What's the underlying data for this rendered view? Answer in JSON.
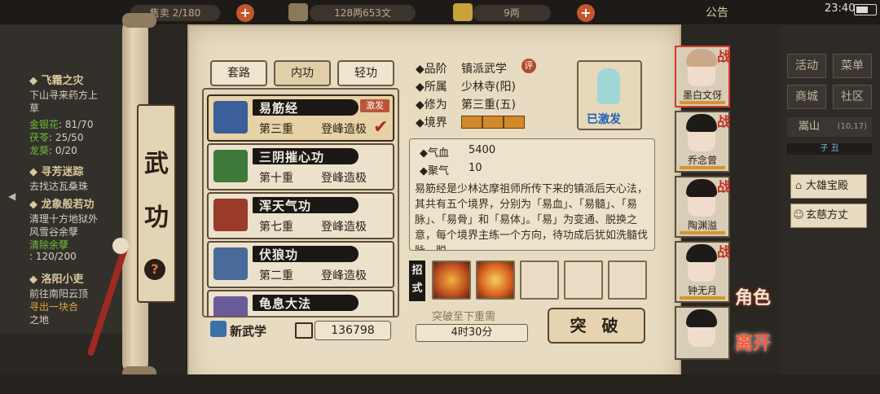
{
  "topbar": {
    "left_label": "售卖",
    "capacity": "2/180",
    "money": "128两653文",
    "gold": "9两",
    "announce": "公告",
    "time": "23:40"
  },
  "quests": [
    {
      "title": "飞霜之灾",
      "lines": [
        "下山寻来药方上",
        "草"
      ],
      "items": [
        [
          "金银花",
          ": 81/70"
        ],
        [
          "茯苓",
          ": 25/50"
        ],
        [
          "龙葵",
          ": 0/20"
        ]
      ]
    },
    {
      "title": "寻芳迷踪",
      "lines": [
        "去找达瓦桑珠"
      ]
    },
    {
      "title": "龙象般若功",
      "lines": [
        "清理十方地狱外",
        "风雪谷余孽",
        "清除余孽",
        ": 120/200"
      ]
    },
    {
      "title": "洛阳小吏",
      "lines": [
        "前往南阳云顶",
        "寻出一块合",
        "之地"
      ]
    }
  ],
  "scroll": {
    "char1": "武",
    "char2": "功",
    "help": "?"
  },
  "tabs": [
    "套路",
    "内功",
    "轻功"
  ],
  "skills": [
    {
      "name": "易筋经",
      "level": "第三重",
      "rank": "登峰造极",
      "badge": "激发",
      "color": "#3a5f9a"
    },
    {
      "name": "三阴摧心功",
      "level": "第十重",
      "rank": "登峰造极",
      "color": "#3f7a3a"
    },
    {
      "name": "浑天气功",
      "level": "第七重",
      "rank": "登峰造极",
      "color": "#9a3a2a"
    },
    {
      "name": "伏狼功",
      "level": "第二重",
      "rank": "登峰造极",
      "color": "#4a6a9a"
    },
    {
      "name": "龟息大法",
      "level": "",
      "rank": "",
      "color": "#6a5a9a"
    }
  ],
  "footer": {
    "new_kungfu": "新武学",
    "count": "136798"
  },
  "detail": {
    "grade_key": "◆品阶",
    "grade": "镇派武学",
    "eval": "评",
    "belong_key": "◆所属",
    "belong": "少林寺(阳)",
    "cultivation_key": "◆修为",
    "cultivation": "第三重(五)",
    "realm_key": "◆境界",
    "realm_filled": 3,
    "portrait_label": "已激发"
  },
  "stats": [
    {
      "key": "◆气血",
      "value": "5400"
    },
    {
      "key": "◆聚气",
      "value": "10"
    }
  ],
  "description": "易筋经是少林达摩祖师所传下来的镇派后天心法，其共有五个境界，分别为「易血」、「易髓」、「易脉」、「易骨」和「易体」。「易」为变通、脱换之意，每个境界主练一个方向，待功成后犹如洗髓伐脉、脱",
  "moves": {
    "label1": "招",
    "label2": "式"
  },
  "breakthrough": {
    "need": "突破至下重需",
    "time": "4时30分",
    "button": "突  破"
  },
  "characters": [
    {
      "name": "墨白文伢",
      "tag": "战",
      "monk": true
    },
    {
      "name": "乔念曾",
      "tag": "战",
      "monk": false
    },
    {
      "name": "陶渊溢",
      "tag": "战",
      "monk": false
    },
    {
      "name": "钟无月",
      "tag": "战",
      "monk": false
    },
    {
      "name": "",
      "tag": "",
      "monk": false
    }
  ],
  "rmenu": {
    "btn1": "活动",
    "btn2": "菜单",
    "btn3": "商城",
    "btn4": "社区",
    "location": "嵩山",
    "coord": "(10,17)",
    "timebar": "子  丑",
    "side1": "大雄宝殿",
    "side2": "玄慈方丈",
    "role": "角色",
    "leave": "离开"
  }
}
